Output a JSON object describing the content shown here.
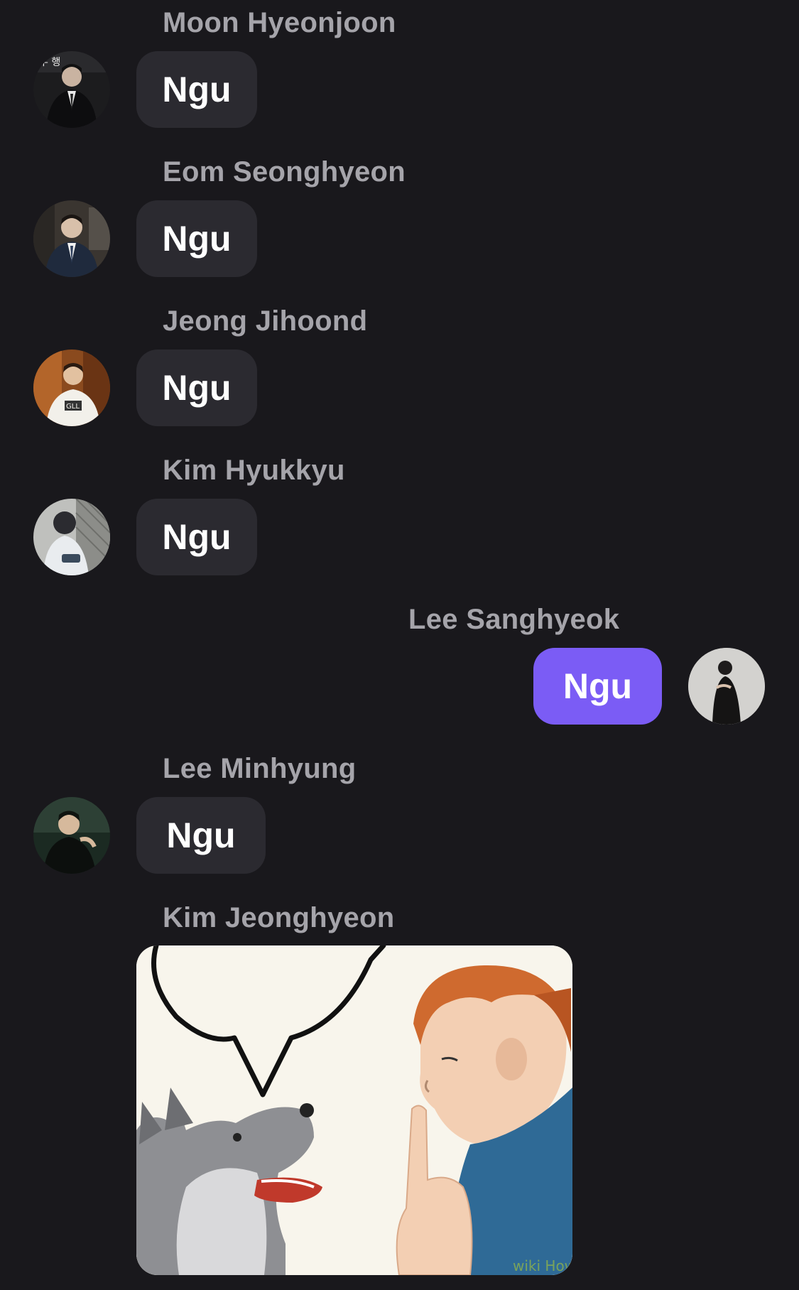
{
  "messages": [
    {
      "sender": "Moon Hyeonjoon",
      "text": "Ngu",
      "avatar": "profile-photo-suit"
    },
    {
      "sender": "Eom Seonghyeon",
      "text": "Ngu",
      "avatar": "profile-photo-suit-office"
    },
    {
      "sender": "Jeong Jihoond",
      "text": "Ngu",
      "avatar": "profile-photo-white-shirt"
    },
    {
      "sender": "Kim Hyukkyu",
      "text": "Ngu",
      "avatar": "profile-photo-sitting"
    },
    {
      "sender": "Lee Sanghyeok",
      "text": "Ngu",
      "avatar": "profile-photo-black-outfit",
      "own": true
    },
    {
      "sender": "Lee Minhyung",
      "text": "Ngu",
      "avatar": "profile-photo-dark"
    },
    {
      "sender": "Kim Jeonghyeon",
      "image": "meme-dog-shush-icon"
    }
  ],
  "colors": {
    "background": "#19181c",
    "incoming_bubble": "#2b2a30",
    "own_bubble": "#7b5cf5",
    "sender_name": "#a5a4aa"
  }
}
